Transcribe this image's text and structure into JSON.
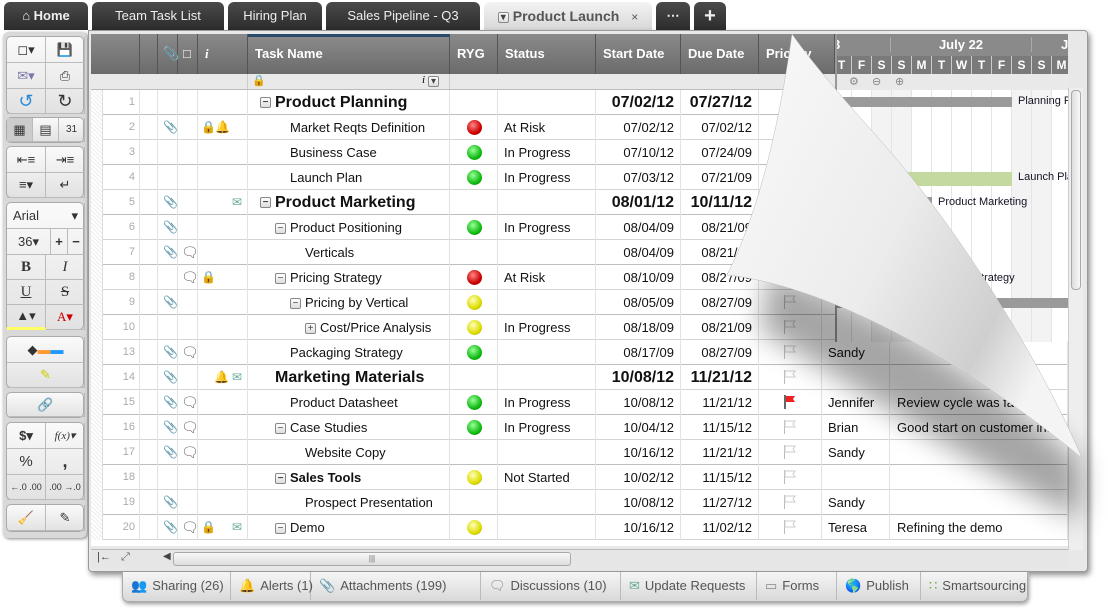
{
  "tabs": [
    {
      "label": "Home"
    },
    {
      "label": "Team Task List"
    },
    {
      "label": "Hiring Plan"
    },
    {
      "label": "Sales Pipeline - Q3"
    },
    {
      "label": "Product Launch"
    },
    {
      "label": "⋯"
    },
    {
      "label": "+"
    }
  ],
  "toolbar": {
    "font": "Arial",
    "size": "36",
    "bold": "B",
    "italic": "I",
    "underline": "U",
    "strike": "S",
    "currency": "$",
    "formula": "f(x)",
    "percent": "%",
    "comma": ",",
    "dec_less": "←.0 .00",
    "dec_more": ".00 →.0"
  },
  "columns": {
    "info": "i",
    "task": "Task Name",
    "ryg": "RYG",
    "status": "Status",
    "start": "Start Date",
    "due": "Due Date",
    "priority": "Priority"
  },
  "rows": [
    {
      "n": "1",
      "task": "Product Planning",
      "lvl": 0,
      "box": "-",
      "style": "bold",
      "start": "07/02/12",
      "due": "07/27/12"
    },
    {
      "n": "2",
      "task": "Market Reqts Definition",
      "lvl": 1,
      "att": true,
      "lock": true,
      "bell": true,
      "ryg": "red",
      "status": "At Risk",
      "start": "07/02/12",
      "due": "07/02/12"
    },
    {
      "n": "3",
      "task": "Business Case",
      "lvl": 1,
      "ryg": "green",
      "status": "In Progress",
      "start": "07/10/12",
      "due": "07/24/09"
    },
    {
      "n": "4",
      "task": "Launch Plan",
      "lvl": 1,
      "ryg": "green",
      "status": "In Progress",
      "start": "07/03/12",
      "due": "07/21/09"
    },
    {
      "n": "5",
      "task": "Product Marketing",
      "lvl": 0,
      "box": "-",
      "style": "bold",
      "att": true,
      "upd": true,
      "start": "08/01/12",
      "due": "10/11/12"
    },
    {
      "n": "6",
      "task": "Product Positioning",
      "lvl": 1,
      "box": "-",
      "att": true,
      "ryg": "green",
      "status": "In Progress",
      "start": "08/04/09",
      "due": "08/21/09"
    },
    {
      "n": "7",
      "task": "Verticals",
      "lvl": 2,
      "att": true,
      "cmt": true,
      "start": "08/04/09",
      "due": "08/21/09"
    },
    {
      "n": "8",
      "task": "Pricing Strategy",
      "lvl": 1,
      "box": "-",
      "cmt": true,
      "lock": true,
      "ryg": "red",
      "status": "At Risk",
      "start": "08/10/09",
      "due": "08/27/09"
    },
    {
      "n": "9",
      "task": "Pricing by Vertical",
      "lvl": 2,
      "box": "-",
      "att": true,
      "ryg": "yellow",
      "start": "08/05/09",
      "due": "08/27/09",
      "flag": "off"
    },
    {
      "n": "10",
      "task": "Cost/Price Analysis",
      "lvl": 3,
      "box": "+",
      "ryg": "yellow",
      "status": "In Progress",
      "start": "08/18/09",
      "due": "08/21/09",
      "flag": "off"
    },
    {
      "n": "13",
      "task": "Packaging Strategy",
      "lvl": 1,
      "att": true,
      "cmt": true,
      "ryg": "green",
      "start": "08/17/09",
      "due": "08/27/09",
      "flag": "off",
      "assigned": "Sandy"
    },
    {
      "n": "14",
      "task": "Marketing Materials",
      "lvl": 0,
      "style": "bold",
      "att": true,
      "bell": true,
      "upd": true,
      "start": "10/08/12",
      "due": "11/21/12",
      "flag": "off"
    },
    {
      "n": "15",
      "task": "Product Datasheet",
      "lvl": 1,
      "att": true,
      "cmt": true,
      "ryg": "green",
      "status": "In Progress",
      "start": "10/08/12",
      "due": "11/21/12",
      "flag": "on",
      "assigned": "Jennifer",
      "comments": "Review cycle was faster th"
    },
    {
      "n": "16",
      "task": "Case Studies",
      "lvl": 1,
      "box": "-",
      "att": true,
      "cmt": true,
      "ryg": "green",
      "status": "In Progress",
      "start": "10/04/12",
      "due": "11/15/12",
      "flag": "off",
      "assigned": "Brian",
      "comments": "Good start on customer interv"
    },
    {
      "n": "17",
      "task": "Website Copy",
      "lvl": 2,
      "att": true,
      "cmt": true,
      "start": "10/16/12",
      "due": "11/21/12",
      "flag": "off",
      "assigned": "Sandy"
    },
    {
      "n": "18",
      "task": "Sales Tools",
      "lvl": 1,
      "box": "-",
      "style": "semi",
      "ryg": "yellow",
      "status": "Not Started",
      "start": "10/02/12",
      "due": "11/15/12",
      "flag": "off"
    },
    {
      "n": "19",
      "task": "Prospect Presentation",
      "lvl": 2,
      "att": true,
      "start": "10/08/12",
      "due": "11/27/12",
      "flag": "off",
      "assigned": "Sandy"
    },
    {
      "n": "20",
      "task": "Demo",
      "lvl": 1,
      "box": "-",
      "att": true,
      "cmt": true,
      "lock": true,
      "upd": true,
      "ryg": "yellow",
      "start": "10/16/12",
      "due": "11/02/12",
      "flag": "off",
      "assigned": "Teresa",
      "comments": "Refining the demo"
    }
  ],
  "gantt": {
    "week_prev": "3",
    "week": "July 22",
    "week_next": "J",
    "days": [
      "T",
      "F",
      "S",
      "S",
      "M",
      "T",
      "W",
      "T",
      "F",
      "S",
      "S",
      "M",
      "T"
    ],
    "labels": {
      "planning": "Planning P",
      "launch": "Launch Pla",
      "marketing": "Product Marketing",
      "pricing": "Pricing Strategy"
    },
    "colors": {
      "summary": "#9a9a9a",
      "task": "#c3d9a0"
    }
  },
  "bottom_tabs": [
    {
      "label": "Sharing (26)",
      "icon": "users-icon"
    },
    {
      "label": "Alerts (1)",
      "icon": "bell-icon"
    },
    {
      "label": "Attachments (199)",
      "icon": "paperclip-icon"
    },
    {
      "label": "Discussions (10)",
      "icon": "comment-icon"
    },
    {
      "label": "Update Requests",
      "icon": "update-request-icon"
    },
    {
      "label": "Forms",
      "icon": "forms-icon"
    },
    {
      "label": "Publish",
      "icon": "globe-icon"
    },
    {
      "label": "Smartsourcing",
      "icon": "smartsourcing-icon"
    }
  ]
}
